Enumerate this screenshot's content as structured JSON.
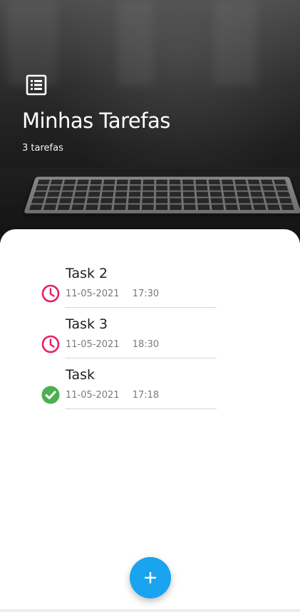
{
  "header": {
    "title": "Minhas Tarefas",
    "subtitle": "3 tarefas",
    "icon": "list-icon"
  },
  "tasks": [
    {
      "name": "Task 2",
      "date": "11-05-2021",
      "time": "17:30",
      "status": "pending",
      "status_icon": "clock-icon",
      "status_color": "#e91e63"
    },
    {
      "name": "Task 3",
      "date": "11-05-2021",
      "time": "18:30",
      "status": "pending",
      "status_icon": "clock-icon",
      "status_color": "#e91e63"
    },
    {
      "name": "Task",
      "date": "11-05-2021",
      "time": "17:18",
      "status": "done",
      "status_icon": "check-circle-icon",
      "status_color": "#4caf50"
    }
  ],
  "fab": {
    "icon": "plus-icon",
    "label": "+",
    "color": "#1aa3ee"
  }
}
